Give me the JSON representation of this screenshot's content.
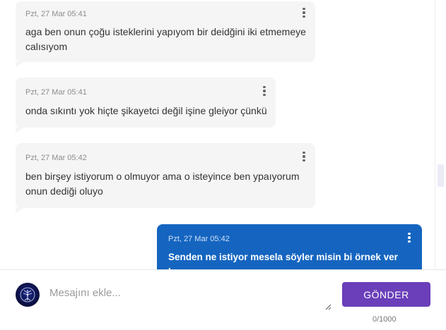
{
  "messages": [
    {
      "direction": "in",
      "meta": "Pzt, 27 Mar 05:41",
      "lines": [
        "aga ben onun çoğu isteklerini yapıyom bir deidğini iki etmemeye",
        "calısıyom"
      ]
    },
    {
      "direction": "in",
      "meta": "Pzt, 27 Mar 05:41",
      "lines": [
        "onda sıkıntı yok hiçte şikayetci değil işine gleiyor çünkü"
      ]
    },
    {
      "direction": "in",
      "meta": "Pzt, 27 Mar 05:42",
      "lines": [
        "ben birşey istiyorum o olmuyor ama o isteyince ben ypaıyorum",
        "onun dediği oluyo"
      ]
    },
    {
      "direction": "out",
      "meta": "Pzt, 27 Mar 05:42",
      "lines": [
        "Senden ne istiyor mesela söyler misin bi örnek ver bana"
      ]
    }
  ],
  "composer": {
    "placeholder": "Mesajını ekle...",
    "value": "",
    "send_label": "GÖNDER",
    "counter": "0/1000"
  },
  "icons": {
    "more": "more-vertical-icon",
    "avatar": "tree-of-life-avatar"
  },
  "colors": {
    "incoming_bubble": "#f5f5f5",
    "outgoing_bubble": "#1565c0",
    "send_button": "#6a3fb9"
  }
}
